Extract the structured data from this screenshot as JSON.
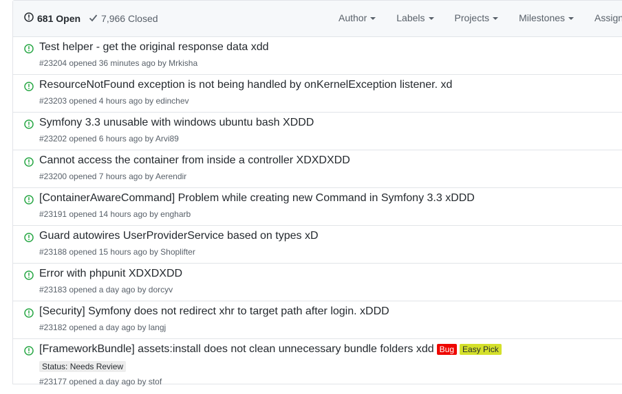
{
  "header": {
    "open_label": "681 Open",
    "closed_label": "7,966 Closed",
    "filters": [
      {
        "label": "Author"
      },
      {
        "label": "Labels"
      },
      {
        "label": "Projects"
      },
      {
        "label": "Milestones"
      },
      {
        "label": "Assignee"
      }
    ]
  },
  "colors": {
    "open_icon": "#28a745",
    "bug_label": "#ee0701",
    "easy_pick_label": "#d4e02b",
    "status_label": "#ededed"
  },
  "issues": [
    {
      "title": "Test helper - get the original response data xdd",
      "meta": "#23204 opened 36 minutes ago by Mrkisha"
    },
    {
      "title": "ResourceNotFound exception is not being handled by onKernelException listener. xd",
      "meta": "#23203 opened 4 hours ago by edinchev"
    },
    {
      "title": "Symfony 3.3 unusable with windows ubuntu bash XDDD",
      "meta": "#23202 opened 6 hours ago by Arvi89"
    },
    {
      "title": "Cannot access the container from inside a controller XDXDXDD",
      "meta": "#23200 opened 7 hours ago by Aerendir"
    },
    {
      "title": "[ContainerAwareCommand] Problem while creating new Command in Symfony 3.3 xDDD",
      "meta": "#23191 opened 14 hours ago by engharb"
    },
    {
      "title": "Guard autowires UserProviderService based on types xD",
      "meta": "#23188 opened 15 hours ago by Shoplifter"
    },
    {
      "title": "Error with phpunit XDXDXDD",
      "meta": "#23183 opened a day ago by dorcyv"
    },
    {
      "title": "[Security] Symfony does not redirect xhr to target path after login. xDDD",
      "meta": "#23182 opened a day ago by langj"
    },
    {
      "title": "[FrameworkBundle] assets:install does not clean unnecessary bundle folders xdd",
      "meta": "#23177 opened a day ago by stof",
      "labels": [
        "Bug",
        "Easy Pick"
      ],
      "status_label": "Status: Needs Review"
    }
  ]
}
